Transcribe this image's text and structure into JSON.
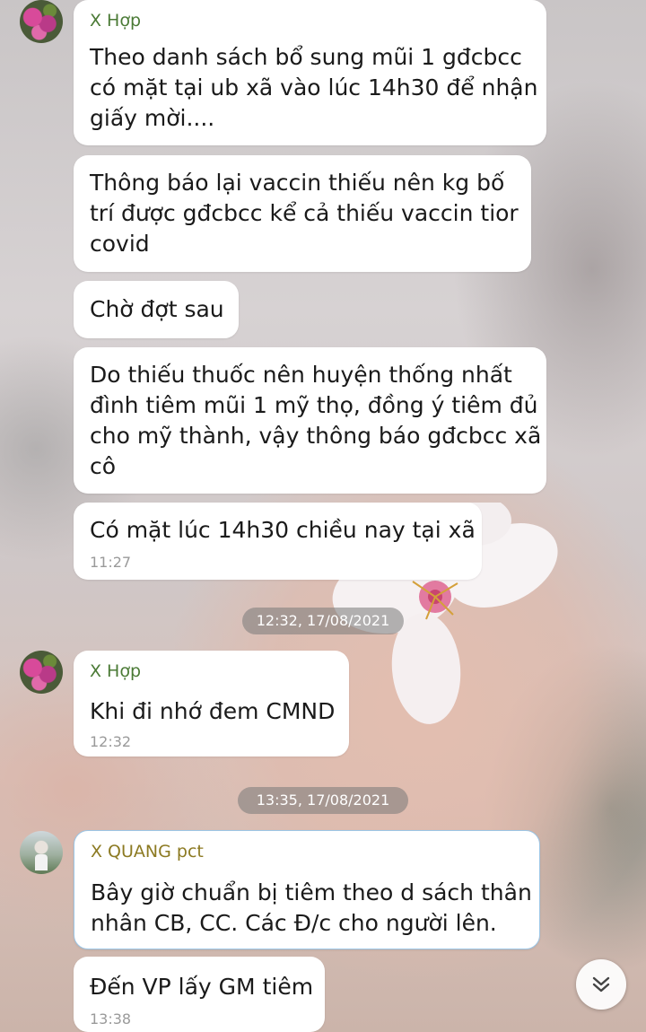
{
  "messages": [
    {
      "sender": "X Hợp",
      "text": "Theo danh sách bổ sung mũi 1 gđcbcc\ncó mặt tại ub xã vào lúc 14h30 để nhận\ngiấy mời...."
    },
    {
      "text": "Thông báo lại vaccin thiếu nên kg bố\ntrí được gđcbcc kể cả thiếu vaccin tior\ncovid"
    },
    {
      "text": "Chờ đợt sau"
    },
    {
      "text": "Do thiếu thuốc nên huyện thống nhất\nđình tiêm mũi 1 mỹ thọ, đồng ý tiêm đủ\ncho mỹ thành, vậy thông báo gđcbcc xã\ncô"
    },
    {
      "text": "Có mặt lúc 14h30 chiều nay tại xã",
      "time": "11:27"
    },
    {
      "sender": "X Hợp",
      "text": "Khi đi nhớ đem CMND",
      "time": "12:32"
    },
    {
      "sender": "X QUANG pct",
      "text": "Bây giờ chuẩn bị tiêm theo d sách thân\nnhân CB, CC. Các Đ/c cho người lên."
    },
    {
      "text": "Đến VP lấy GM tiêm",
      "time": "13:38"
    }
  ],
  "date_separators": [
    "12:32, 17/08/2021",
    "13:35, 17/08/2021"
  ],
  "icons": {
    "scroll_down": "double-chevron-down-icon",
    "avatar_1": "flower-avatar",
    "avatar_2": "person-avatar"
  },
  "colors": {
    "sender_name": "#4a7a35",
    "sender_name_alt": "#8c7a22",
    "bubble": "#ffffff",
    "selected_bubble_border": "#9cc6e6",
    "time_text": "#9a9a9a"
  }
}
